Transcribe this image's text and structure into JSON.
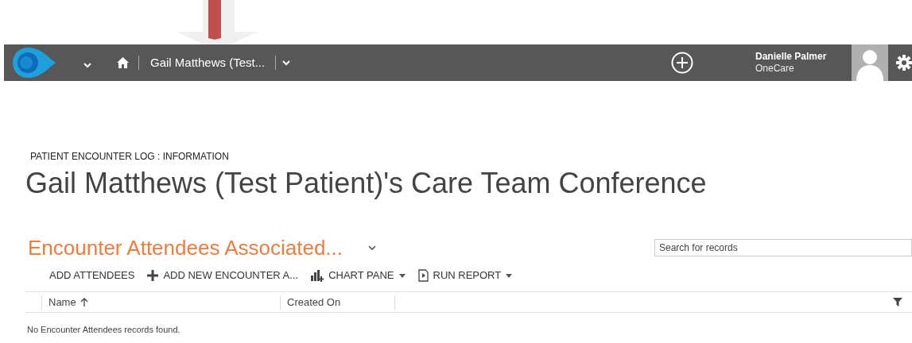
{
  "nav_bar": {
    "breadcrumb": "Gail Matthews (Test...",
    "user": {
      "name": "Danielle Palmer",
      "organization": "OneCare"
    }
  },
  "record": {
    "entity_label": "PATIENT ENCOUNTER LOG : INFORMATION",
    "title": "Gail Matthews (Test Patient)'s Care Team Conference"
  },
  "subgrid": {
    "title": "Encounter Attendees Associated...",
    "search": {
      "placeholder": "Search for records"
    },
    "commands": [
      {
        "kind": "plain",
        "label": "ADD ATTENDEES"
      },
      {
        "kind": "add",
        "label": "ADD NEW ENCOUNTER A..."
      },
      {
        "kind": "chart",
        "label": "CHART PANE"
      },
      {
        "kind": "report",
        "label": "RUN REPORT"
      }
    ],
    "columns": [
      {
        "label": "Name",
        "sorted": true
      },
      {
        "label": "Created On",
        "sorted": false
      }
    ],
    "empty_message": "No Encounter Attendees records found."
  }
}
